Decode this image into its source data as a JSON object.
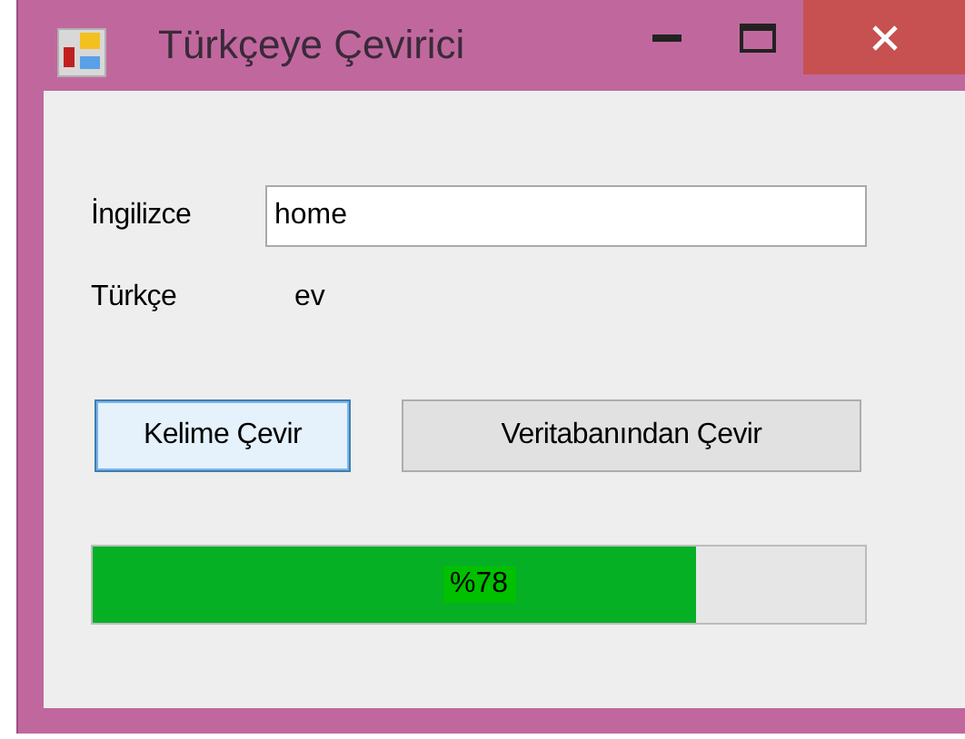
{
  "window": {
    "title": "Türkçeye Çevirici"
  },
  "fields": [
    {
      "kind": "input",
      "label": "İngilizce",
      "value": "home"
    },
    {
      "kind": "output",
      "label": "Türkçe",
      "value": "ev"
    }
  ],
  "buttons": [
    {
      "label": "Kelime Çevir",
      "focused": true
    },
    {
      "label": "Veritabanından Çevir",
      "focused": false
    }
  ],
  "progress": {
    "level": 0.78,
    "label": "%78"
  }
}
